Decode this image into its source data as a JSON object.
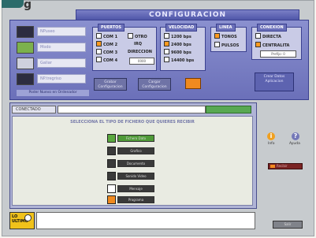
{
  "header": {
    "brand_letter": "g",
    "title": "CONFIGURACION"
  },
  "device_list": {
    "items": [
      {
        "label": "NPuseo",
        "icon": "pc-icon",
        "selected": true
      },
      {
        "label": "Modo",
        "icon": "modem-icon",
        "selected": false
      },
      {
        "label": "Galiar",
        "icon": "gallery-icon",
        "selected": false
      },
      {
        "label": "NP.tregriso",
        "icon": "device-icon",
        "selected": true
      }
    ],
    "caption": "Poder Nuevo en Ordenador"
  },
  "puertos": {
    "title": "PUERTOS",
    "options": [
      {
        "label": "COM 1",
        "checked": false
      },
      {
        "label": "COM 2",
        "checked": true
      },
      {
        "label": "COM 3",
        "checked": false
      },
      {
        "label": "COM 4",
        "checked": false
      }
    ],
    "otro": {
      "label": "OTRO",
      "checked": false
    },
    "irq_label": "IRQ",
    "direccion_label": "DIRECCION",
    "field_value": "0000"
  },
  "velocidad": {
    "title": "VELOCIDAD",
    "options": [
      {
        "label": "1200 bps",
        "checked": false
      },
      {
        "label": "2400 bps",
        "checked": true
      },
      {
        "label": "9600 bps",
        "checked": false
      },
      {
        "label": "14400 bps",
        "checked": false
      }
    ]
  },
  "linea": {
    "title": "LINEA",
    "options": [
      {
        "label": "TONOS",
        "checked": true
      },
      {
        "label": "PULSOS",
        "checked": false
      }
    ]
  },
  "conexion": {
    "title": "CONEXION",
    "options": [
      {
        "label": "DIRECTA",
        "checked": false
      },
      {
        "label": "CENTRALITA",
        "checked": true
      }
    ],
    "field_value": "Prefijo: 0"
  },
  "panel_buttons": {
    "btn1": "Grabar Configuracion",
    "btn2": "Cargar Configuracion",
    "btn3": "Crear Datos Aplicacion"
  },
  "connection": {
    "status_label": "CONECTADO"
  },
  "file_types": {
    "instruction": "SELECCIONA EL TIPO DE FICHERO QUE QUIERES RECIBIR",
    "items": [
      {
        "label": "Fichero Dato",
        "square_color": "#5aa83f",
        "bar_color": "#4f9a38"
      },
      {
        "label": "Grafico",
        "square_color": "#3a3a3a",
        "bar_color": "#3a3a3a"
      },
      {
        "label": "Documento",
        "square_color": "#3a3a3a",
        "bar_color": "#3a3a3a"
      },
      {
        "label": "Sonido Video",
        "square_color": "#3a3a3a",
        "bar_color": "#3a3a3a"
      },
      {
        "label": "Mensaje",
        "square_color": "#ffffff",
        "bar_color": "#3a3a3a"
      },
      {
        "label": "Programa",
        "square_color": "#f08a1f",
        "bar_color": "#3a3a3a"
      }
    ]
  },
  "sidebar": {
    "info_label": "Info",
    "help_label": "Ayuda",
    "action_label": "Recibir"
  },
  "footer": {
    "logo_text": "LO ULTIMO",
    "exit_label": "Salir"
  },
  "colors": {
    "panel_blue": "#6b70b9",
    "accent_orange": "#f08a1f",
    "status_green": "#58a852"
  }
}
